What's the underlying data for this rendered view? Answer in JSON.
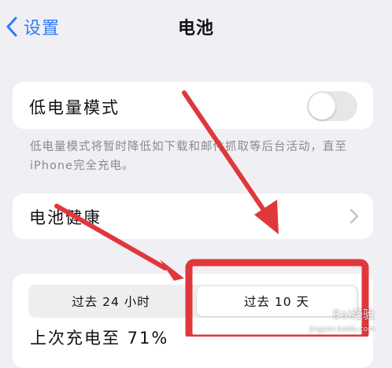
{
  "nav": {
    "back_label": "设置",
    "title": "电池",
    "back_icon": "chevron-left-icon"
  },
  "low_power": {
    "label": "低电量模式",
    "toggle_on": false,
    "footnote": "低电量模式将暂时降低如下载和邮件抓取等后台活动，直至iPhone完全充电。"
  },
  "battery_health": {
    "label": "电池健康",
    "chevron_icon": "chevron-right-icon"
  },
  "usage": {
    "segments": [
      "过去 24 小时",
      "过去 10 天"
    ],
    "selected_segment": "过去 10 天",
    "last_charge": "上次充电至 71%"
  },
  "watermark": {
    "text": "Bai经验",
    "sub": "jingyan.baidu.com"
  },
  "colors": {
    "accent": "#2f7cf6",
    "annotation_red": "#e0373b",
    "background": "#efeff4"
  }
}
